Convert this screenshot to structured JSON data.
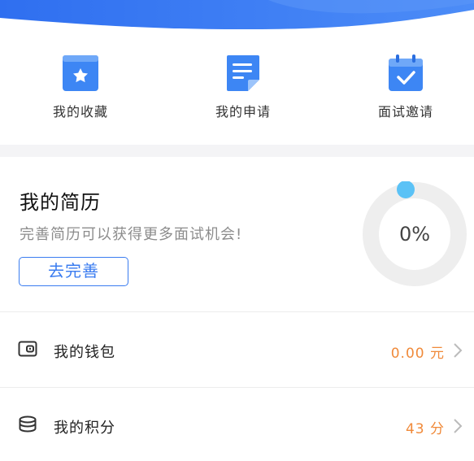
{
  "quick_actions": [
    {
      "label": "我的收藏",
      "icon": "bookmark-star-icon"
    },
    {
      "label": "我的申请",
      "icon": "document-icon"
    },
    {
      "label": "面试邀请",
      "icon": "calendar-check-icon"
    }
  ],
  "resume": {
    "title": "我的简历",
    "subtitle": "完善简历可以获得更多面试机会!",
    "button_label": "去完善",
    "progress_text": "0%",
    "progress": 0
  },
  "menu": [
    {
      "label": "我的钱包",
      "value": "0.00 元",
      "icon": "wallet-icon"
    },
    {
      "label": "我的积分",
      "value": "43 分",
      "icon": "coins-stack-icon"
    }
  ],
  "colors": {
    "accent": "#3a7cf0",
    "value_orange": "#f08a3a",
    "progress_dot": "#5bc2f6",
    "ring_track": "#eeeeee"
  }
}
